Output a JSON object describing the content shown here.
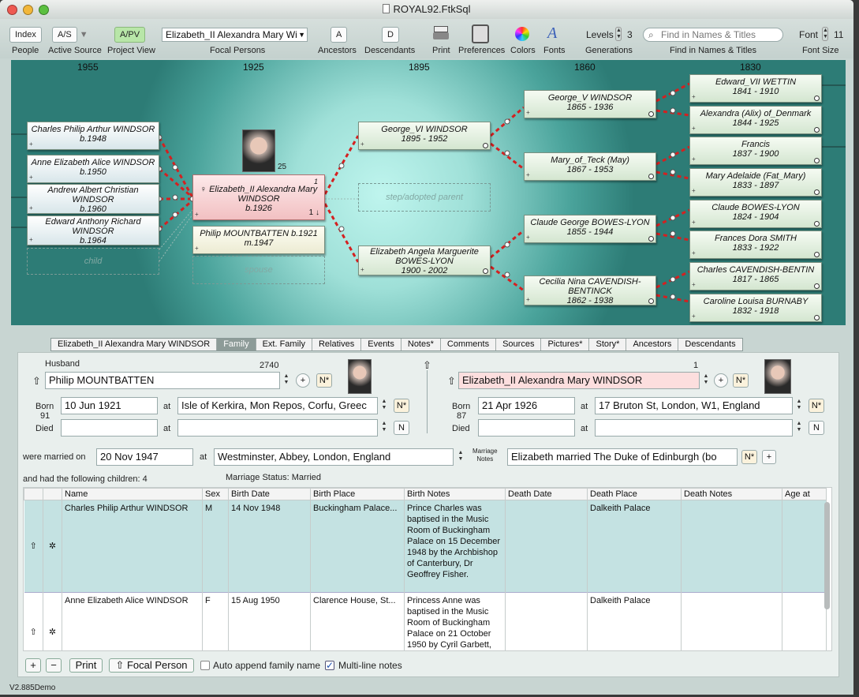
{
  "window": {
    "title": "ROYAL92.FtkSql",
    "version": "V2.885Demo"
  },
  "toolbar": {
    "index": "Index",
    "as": "A/S",
    "apv": "A/PV",
    "focal_value": "Elizabeth_II Alexandra Mary Wi",
    "ancestors_btn": "A",
    "descendants_btn": "D",
    "levels_label": "Levels",
    "levels_value": "3",
    "search_placeholder": "Find in Names & Titles",
    "font_label": "Font",
    "font_value": "11",
    "labels": {
      "people": "People",
      "active_source": "Active Source",
      "project_view": "Project View",
      "focal_persons": "Focal Persons",
      "ancestors": "Ancestors",
      "descendants": "Descendants",
      "print": "Print",
      "preferences": "Preferences",
      "colors": "Colors",
      "fonts": "Fonts",
      "generations": "Generations",
      "find": "Find in Names & Titles",
      "font_size": "Font Size"
    }
  },
  "chart": {
    "years": [
      "1955",
      "1925",
      "1895",
      "1860",
      "1830"
    ],
    "children": [
      {
        "name": "Charles Philip Arthur WINDSOR",
        "dates": "b.1948"
      },
      {
        "name": "Anne Elizabeth Alice WINDSOR",
        "dates": "b.1950"
      },
      {
        "name": "Andrew Albert Christian WINDSOR",
        "dates": "b.1960"
      },
      {
        "name": "Edward Anthony Richard WINDSOR",
        "dates": "b.1964"
      }
    ],
    "child_placeholder": "child",
    "focal": {
      "name": "♀ Elizabeth_II Alexandra Mary WINDSOR",
      "dates": "b.1926",
      "num": "1",
      "num2": "1 ↓",
      "photo_count": "25"
    },
    "spouse": {
      "name": "Philip MOUNTBATTEN b.1921",
      "dates": "m.1947"
    },
    "spouse_placeholder": "spouse",
    "parents": [
      {
        "name": "George_VI WINDSOR",
        "dates": "1895 - 1952"
      },
      {
        "name": "Elizabeth Angela Marguerite BOWES-LYON",
        "dates": "1900 - 2002"
      }
    ],
    "step_placeholder": "step/adopted parent",
    "grandparents": [
      {
        "name": "George_V WINDSOR",
        "dates": "1865 - 1936"
      },
      {
        "name": "Mary_of_Teck (May)",
        "dates": "1867 - 1953"
      },
      {
        "name": "Claude George BOWES-LYON",
        "dates": "1855 - 1944"
      },
      {
        "name": "Cecilia Nina CAVENDISH-BENTINCK",
        "dates": "1862 - 1938"
      }
    ],
    "great_grandparents": [
      {
        "name": "Edward_VII WETTIN",
        "dates": "1841 - 1910"
      },
      {
        "name": "Alexandra (Alix) of_Denmark",
        "dates": "1844 - 1925"
      },
      {
        "name": "Francis",
        "dates": "1837 - 1900"
      },
      {
        "name": "Mary Adelaide (Fat_Mary)",
        "dates": "1833 - 1897"
      },
      {
        "name": "Claude BOWES-LYON",
        "dates": "1824 - 1904"
      },
      {
        "name": "Frances Dora SMITH",
        "dates": "1833 - 1922"
      },
      {
        "name": "Charles CAVENDISH-BENTIN",
        "dates": "1817 - 1865"
      },
      {
        "name": "Caroline Louisa BURNABY",
        "dates": "1832 - 1918"
      }
    ]
  },
  "tabs": [
    "Elizabeth_II Alexandra Mary WINDSOR",
    "Family",
    "Ext. Family",
    "Relatives",
    "Events",
    "Notes*",
    "Comments",
    "Sources",
    "Pictures*",
    "Story*",
    "Ancestors",
    "Descendants"
  ],
  "family": {
    "husband_label": "Husband",
    "husband_num": "2740",
    "husband_name": "Philip MOUNTBATTEN",
    "husband_born": "10 Jun 1921",
    "husband_born_place": "Isle of Kerkira, Mon Repos, Corfu, Greec",
    "husband_age": "91",
    "husband_died": "",
    "husband_died_place": "",
    "wife_num": "1",
    "wife_name": "Elizabeth_II Alexandra Mary WINDSOR",
    "wife_born": "21 Apr 1926",
    "wife_born_place": "17 Bruton St, London, W1, England",
    "wife_age": "87",
    "wife_died": "",
    "wife_died_place": "",
    "born_label": "Born",
    "died_label": "Died",
    "at_label": "at",
    "nstar": "N*",
    "n": "N",
    "plus": "+",
    "married_label": "were married on",
    "married_date": "20 Nov 1947",
    "married_place": "Westminster, Abbey, London, England",
    "marriage_notes_label1": "Marriage",
    "marriage_notes_label2": "Notes",
    "marriage_notes": "Elizabeth married The Duke of Edinburgh (bo",
    "children_label": "and had the following children: 4",
    "marriage_status": "Marriage Status: Married"
  },
  "children_table": {
    "headers": [
      "",
      "",
      "Name",
      "Sex",
      "Birth Date",
      "Birth Place",
      "Birth Notes",
      "Death Date",
      "Death Place",
      "Death Notes",
      "Age at"
    ],
    "rows": [
      {
        "up": "⇧",
        "star": "✲",
        "name": "Charles Philip Arthur WINDSOR",
        "sex": "M",
        "bdate": "14 Nov 1948",
        "bplace": "Buckingham Palace...",
        "bnotes": "Prince Charles was baptised in the Music Room of Buckingham Palace on 15 December 1948 by the Archbishop of Canterbury, Dr Geoffrey Fisher.",
        "ddate": "",
        "dplace": "Dalkeith Palace",
        "dnotes": "",
        "age": ""
      },
      {
        "up": "⇧",
        "star": "✲",
        "name": "Anne Elizabeth Alice WINDSOR",
        "sex": "F",
        "bdate": "15 Aug 1950",
        "bplace": "Clarence House, St...",
        "bnotes": "Princess Anne was baptised in the Music Room of Buckingham Palace on 21 October 1950 by Cyril Garbett,",
        "ddate": "",
        "dplace": "Dalkeith Palace",
        "dnotes": "",
        "age": ""
      }
    ]
  },
  "bottom": {
    "add": "+",
    "remove": "−",
    "print": "Print",
    "focal": "⇧ Focal Person",
    "auto_append": "Auto append family name",
    "multiline": "Multi-line notes"
  },
  "colors": {
    "focal": "#f2c0c2",
    "chart_bg": "#9fe0d8",
    "connector": "#d42020"
  }
}
